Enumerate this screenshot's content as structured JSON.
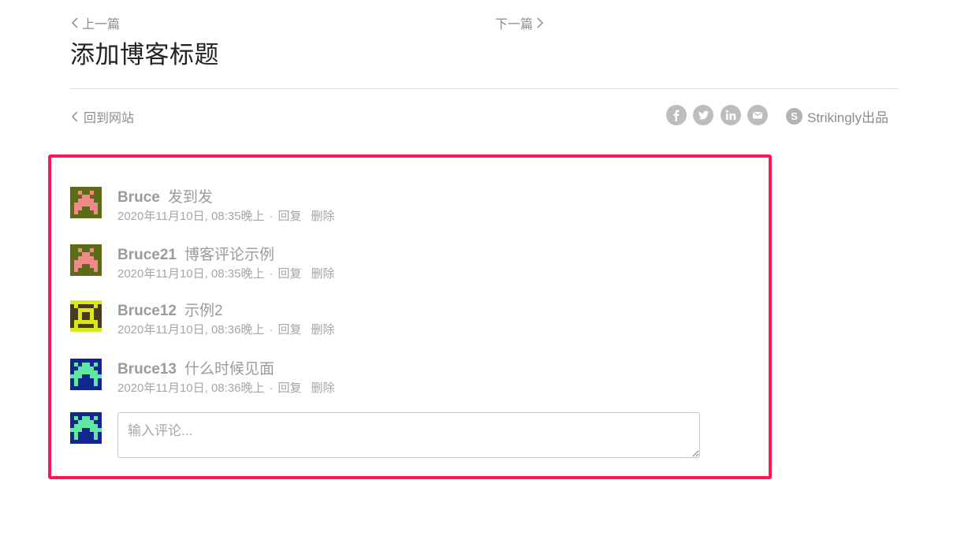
{
  "nav": {
    "prev_label": "上一篇",
    "next_label": "下一篇"
  },
  "post": {
    "title": "添加博客标题"
  },
  "footer": {
    "back_label": "回到网站",
    "share_icons": [
      "facebook-icon",
      "twitter-icon",
      "linkedin-icon",
      "email-icon"
    ],
    "brand_logo_letter": "S",
    "brand_label": "Strikingly出品"
  },
  "colors": {
    "highlight_border": "#ff1558",
    "muted_text": "#9b9b9b",
    "share_icon_bg": "#bdbdbd"
  },
  "comments": [
    {
      "author": "Bruce",
      "text": "发到发",
      "timestamp": "2020年11月10日, 08:35晚上",
      "separator": "·",
      "reply_label": "回复",
      "delete_label": "删除",
      "avatar": "olive-pink-pixel-avatar"
    },
    {
      "author": "Bruce21",
      "text": "博客评论示例",
      "timestamp": "2020年11月10日, 08:35晚上",
      "separator": "·",
      "reply_label": "回复",
      "delete_label": "删除",
      "avatar": "olive-pink-pixel-avatar"
    },
    {
      "author": "Bruce12",
      "text": "示例2",
      "timestamp": "2020年11月10日, 08:36晚上",
      "separator": "·",
      "reply_label": "回复",
      "delete_label": "删除",
      "avatar": "brown-yellow-pixel-avatar"
    },
    {
      "author": "Bruce13",
      "text": "什么时候见面",
      "timestamp": "2020年11月10日, 08:36晚上",
      "separator": "·",
      "reply_label": "回复",
      "delete_label": "删除",
      "avatar": "navy-green-pixel-avatar"
    }
  ],
  "composer": {
    "placeholder": "输入评论...",
    "value": "",
    "avatar": "navy-green-pixel-avatar"
  }
}
